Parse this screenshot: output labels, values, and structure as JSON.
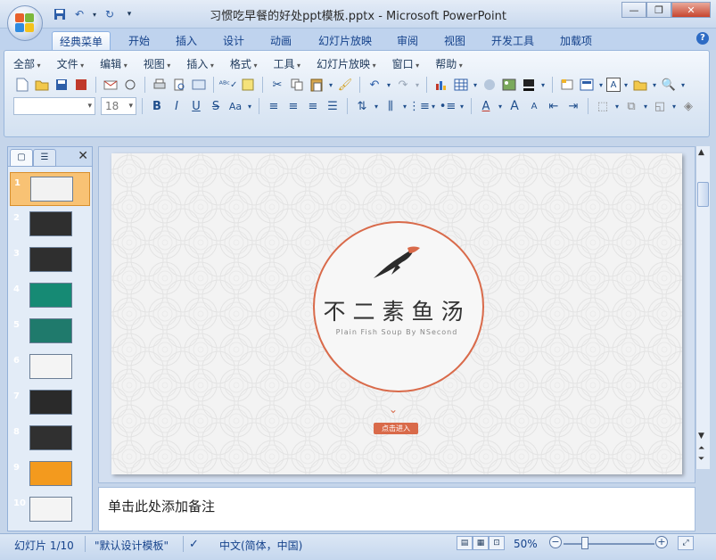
{
  "window": {
    "title": "习惯吃早餐的好处ppt模板.pptx - Microsoft PowerPoint"
  },
  "ribbon_tabs": [
    "经典菜单",
    "开始",
    "插入",
    "设计",
    "动画",
    "幻灯片放映",
    "审阅",
    "视图",
    "开发工具",
    "加载项"
  ],
  "classic_menu": [
    "全部",
    "文件",
    "编辑",
    "视图",
    "插入",
    "格式",
    "工具",
    "幻灯片放映",
    "窗口",
    "帮助"
  ],
  "font": {
    "name_value": "",
    "size_value": "18"
  },
  "slides_pane": {
    "thumbnails": [
      {
        "num": "1",
        "bg": "#f2f2f2",
        "selected": true
      },
      {
        "num": "2",
        "bg": "#2f2f2f"
      },
      {
        "num": "3",
        "bg": "#2f2f2f"
      },
      {
        "num": "4",
        "bg": "#168a74"
      },
      {
        "num": "5",
        "bg": "#1f7a6c"
      },
      {
        "num": "6",
        "bg": "#f4f4f4"
      },
      {
        "num": "7",
        "bg": "#2a2a2a"
      },
      {
        "num": "8",
        "bg": "#303030"
      },
      {
        "num": "9",
        "bg": "#f39a1e"
      },
      {
        "num": "10",
        "bg": "#f4f4f4"
      }
    ]
  },
  "slide": {
    "title": "不二素鱼汤",
    "subtitle": "Plain Fish Soup By NSecond",
    "enter_label": "点击进入",
    "accent": "#d96a4a"
  },
  "notes": {
    "placeholder": "单击此处添加备注"
  },
  "status": {
    "slide_counter": "幻灯片 1/10",
    "theme": "\"默认设计模板\"",
    "language": "中文(简体，中国)",
    "zoom": "50%"
  }
}
